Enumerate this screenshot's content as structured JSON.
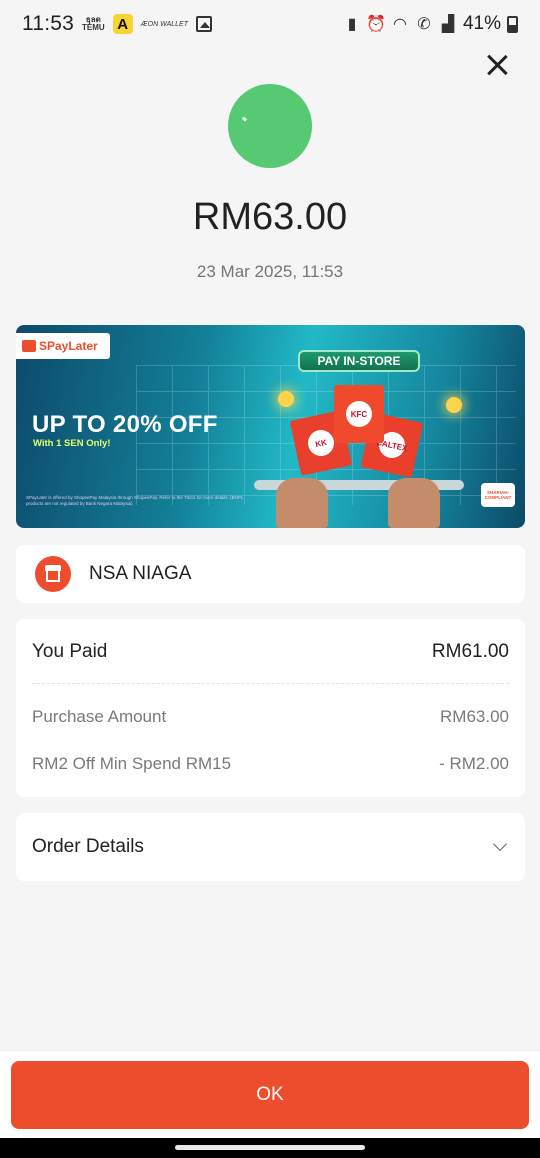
{
  "status_bar": {
    "time": "11:53",
    "app_temu_line1": "ธุลด",
    "app_temu_line2": "TEMU",
    "app_a": "A",
    "app_aeon": "ÆON WALLET",
    "battery": "41%",
    "icons": [
      "temu-icon",
      "a-app-icon",
      "aeon-wallet-icon",
      "gallery-icon",
      "battery-saver-icon",
      "alarm-icon",
      "wifi-icon",
      "wifi-calling-icon",
      "signal-icon",
      "battery-icon"
    ]
  },
  "receipt": {
    "amount": "RM63.00",
    "datetime": "23 Mar 2025, 11:53",
    "status_color": "#57c973"
  },
  "banner": {
    "brand": "SPayLater",
    "headline": "UP TO 20% OFF",
    "subline": "With 1 SEN Only!",
    "badge": "PAY IN-STORE",
    "bag_labels": [
      "KK",
      "KFC",
      "CALTEX"
    ],
    "shariah": "SHARIAH-COMPLIANT",
    "disclaimer": "SPayLater is offered by ShopeePay Malaysia through ShopeePay. Refer to the T&Cs for more details. (BNPL products are not regulated by Bank Negara Malaysia)"
  },
  "merchant": {
    "name": "NSA NIAGA",
    "icon": "shop-icon"
  },
  "payment": {
    "you_paid_label": "You Paid",
    "you_paid_value": "RM61.00",
    "purchase_label": "Purchase Amount",
    "purchase_value": "RM63.00",
    "voucher_label": "RM2 Off Min Spend RM15",
    "voucher_value": "- RM2.00"
  },
  "order_details": {
    "label": "Order Details"
  },
  "footer": {
    "ok_label": "OK",
    "accent": "#ee4d2d"
  }
}
